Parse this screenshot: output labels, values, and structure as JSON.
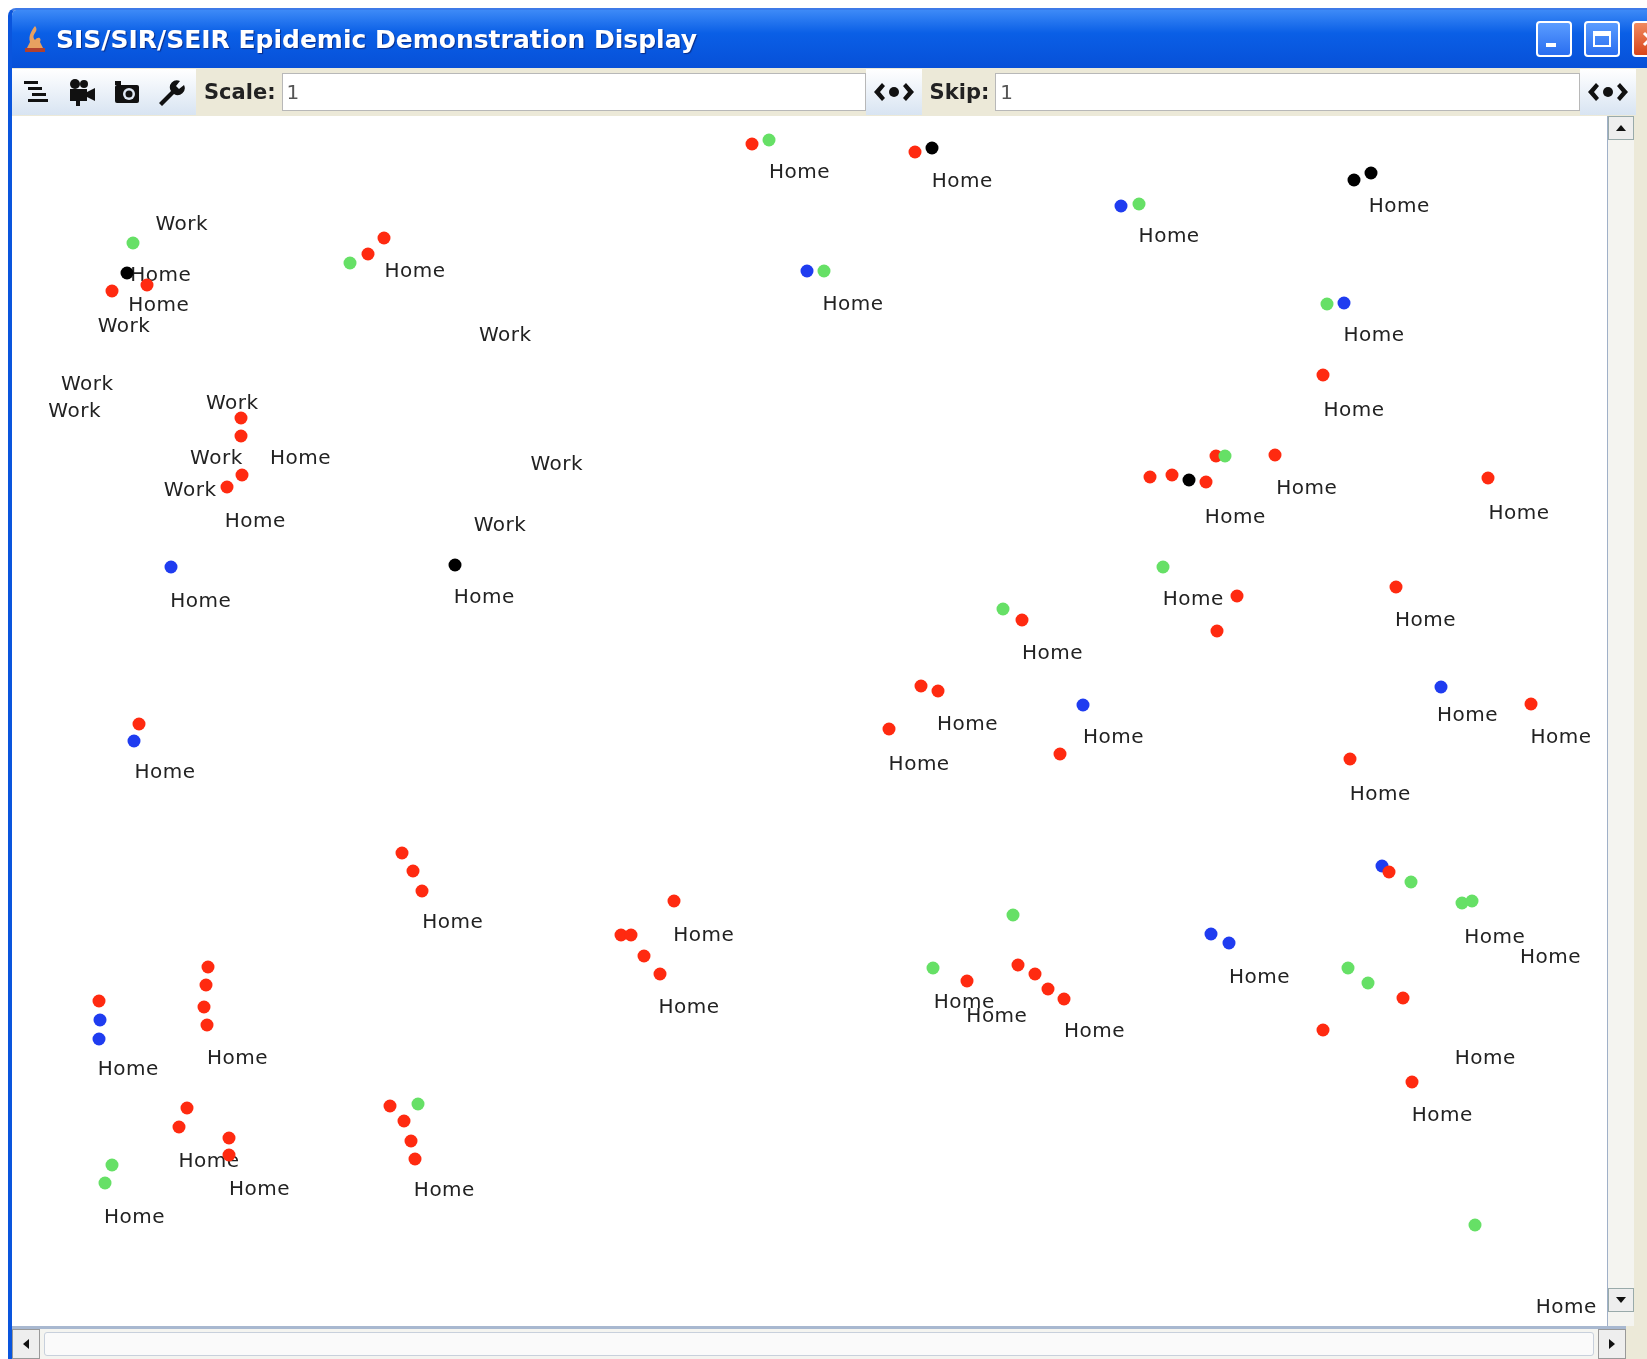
{
  "window": {
    "title": "SIS/SIR/SEIR Epidemic Demonstration Display"
  },
  "toolbar": {
    "scale": {
      "label": "Scale:",
      "value": "1"
    },
    "skip": {
      "label": "Skip:",
      "value": "1"
    }
  },
  "labels": [
    "Home",
    "Home",
    "Home",
    "Work",
    "Home",
    "Home",
    "Home",
    "Home",
    "Home",
    "Work",
    "Work",
    "Home",
    "Work",
    "Work",
    "Work",
    "Home",
    "Work",
    "Home",
    "Work",
    "Work",
    "Home",
    "Home",
    "Work",
    "Home",
    "Home",
    "Home",
    "Home",
    "Home",
    "Home",
    "Home",
    "Home",
    "Home",
    "Home",
    "Home",
    "Home",
    "Home",
    "Home",
    "Home",
    "Home",
    "Home",
    "Home",
    "Home",
    "Home",
    "Home",
    "Home",
    "Home",
    "Home",
    "Home",
    "Home",
    "Home",
    "Home",
    "Home",
    "Home",
    "Home",
    "Home"
  ],
  "dots": [
    {
      "color": "#ff2a10"
    },
    {
      "color": "#66e066"
    },
    {
      "color": "#ff2a10"
    },
    {
      "color": "#000000"
    },
    {
      "color": "#1f3cf0"
    },
    {
      "color": "#66e066"
    },
    {
      "color": "#000000"
    },
    {
      "color": "#000000"
    },
    {
      "color": "#66e066"
    },
    {
      "color": "#000000"
    },
    {
      "color": "#ff2a10"
    },
    {
      "color": "#ff2a10"
    },
    {
      "color": "#66e066"
    },
    {
      "color": "#ff2a10"
    },
    {
      "color": "#ff2a10"
    },
    {
      "color": "#1f3cf0"
    },
    {
      "color": "#66e066"
    },
    {
      "color": "#66e066"
    },
    {
      "color": "#1f3cf0"
    },
    {
      "color": "#ff2a10"
    },
    {
      "color": "#ff2a10"
    },
    {
      "color": "#ff2a10"
    },
    {
      "color": "#ff2a10"
    },
    {
      "color": "#ff2a10"
    },
    {
      "color": "#ff2a10"
    },
    {
      "color": "#ff2a10"
    },
    {
      "color": "#000000"
    },
    {
      "color": "#ff2a10"
    },
    {
      "color": "#ff2a10"
    },
    {
      "color": "#66e066"
    },
    {
      "color": "#ff2a10"
    },
    {
      "color": "#ff2a10"
    },
    {
      "color": "#1f3cf0"
    },
    {
      "color": "#000000"
    },
    {
      "color": "#66e066"
    },
    {
      "color": "#ff2a10"
    },
    {
      "color": "#ff2a10"
    },
    {
      "color": "#ff2a10"
    },
    {
      "color": "#66e066"
    },
    {
      "color": "#ff2a10"
    },
    {
      "color": "#ff2a10"
    },
    {
      "color": "#ff2a10"
    },
    {
      "color": "#ff2a10"
    },
    {
      "color": "#1f3cf0"
    },
    {
      "color": "#ff2a10"
    },
    {
      "color": "#1f3cf0"
    },
    {
      "color": "#ff2a10"
    },
    {
      "color": "#ff2a10"
    },
    {
      "color": "#ff2a10"
    },
    {
      "color": "#1f3cf0"
    },
    {
      "color": "#ff2a10"
    },
    {
      "color": "#ff2a10"
    },
    {
      "color": "#ff2a10"
    },
    {
      "color": "#ff2a10"
    },
    {
      "color": "#ff2a10"
    },
    {
      "color": "#ff2a10"
    },
    {
      "color": "#ff2a10"
    },
    {
      "color": "#ff2a10"
    },
    {
      "color": "#1f3cf0"
    },
    {
      "color": "#ff2a10"
    },
    {
      "color": "#66e066"
    },
    {
      "color": "#66e066"
    },
    {
      "color": "#66e066"
    },
    {
      "color": "#66e066"
    },
    {
      "color": "#66e066"
    },
    {
      "color": "#ff2a10"
    },
    {
      "color": "#ff2a10"
    },
    {
      "color": "#ff2a10"
    },
    {
      "color": "#ff2a10"
    },
    {
      "color": "#ff2a10"
    },
    {
      "color": "#1f3cf0"
    },
    {
      "color": "#1f3cf0"
    },
    {
      "color": "#66e066"
    },
    {
      "color": "#66e066"
    },
    {
      "color": "#ff2a10"
    },
    {
      "color": "#ff2a10"
    },
    {
      "color": "#ff2a10"
    },
    {
      "color": "#66e066"
    },
    {
      "color": "#ff2a10"
    },
    {
      "color": "#1f3cf0"
    },
    {
      "color": "#1f3cf0"
    },
    {
      "color": "#ff2a10"
    },
    {
      "color": "#ff2a10"
    },
    {
      "color": "#ff2a10"
    },
    {
      "color": "#ff2a10"
    },
    {
      "color": "#ff2a10"
    },
    {
      "color": "#ff2a10"
    },
    {
      "color": "#ff2a10"
    },
    {
      "color": "#ff2a10"
    },
    {
      "color": "#ff2a10"
    },
    {
      "color": "#66e066"
    },
    {
      "color": "#ff2a10"
    },
    {
      "color": "#ff2a10"
    },
    {
      "color": "#ff2a10"
    },
    {
      "color": "#66e066"
    },
    {
      "color": "#66e066"
    }
  ]
}
